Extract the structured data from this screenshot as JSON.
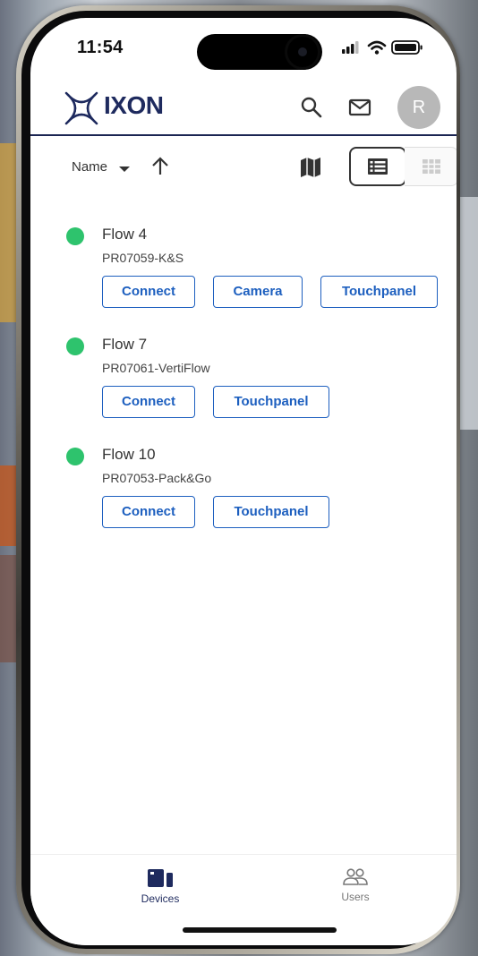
{
  "status_bar": {
    "time": "11:54"
  },
  "header": {
    "brand": "IXON",
    "logo_icon": "ixon-logo-icon",
    "search_icon": "search-icon",
    "mail_icon": "mail-icon",
    "avatar_initial": "R"
  },
  "toolbar": {
    "sort_label": "Name",
    "sort_direction_icon": "arrow-up-icon",
    "map_icon": "map-icon",
    "list_view_icon": "list-view-icon",
    "grid_view_icon": "grid-view-icon",
    "active_view": "list"
  },
  "devices": [
    {
      "name": "Flow 4",
      "id": "PR07059-K&S",
      "status": "online",
      "actions": [
        "Connect",
        "Camera",
        "Touchpanel"
      ]
    },
    {
      "name": "Flow 7",
      "id": "PR07061-VertiFlow",
      "status": "online",
      "actions": [
        "Connect",
        "Touchpanel"
      ]
    },
    {
      "name": "Flow 10",
      "id": "PR07053-Pack&Go",
      "status": "online",
      "actions": [
        "Connect",
        "Touchpanel"
      ]
    }
  ],
  "bottom_nav": {
    "items": [
      {
        "label": "Devices",
        "icon": "devices-icon",
        "active": true
      },
      {
        "label": "Users",
        "icon": "users-icon",
        "active": false
      }
    ]
  },
  "colors": {
    "brand": "#1e2a5e",
    "accent": "#1d5fbf",
    "online": "#2ec36d"
  }
}
